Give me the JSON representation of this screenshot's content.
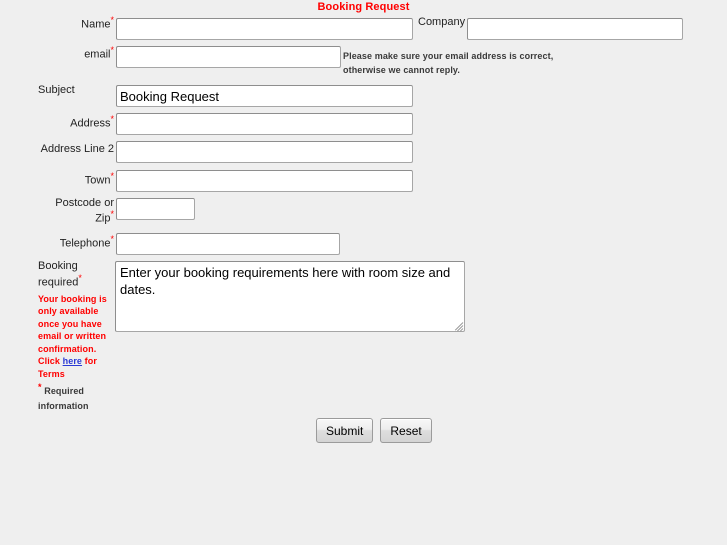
{
  "page": {
    "title": "Booking Request",
    "title_color": "#ff0000",
    "background_color": "#efefef"
  },
  "fields": {
    "name": {
      "label": "Name",
      "required_marker": "*",
      "value": "",
      "placeholder": ""
    },
    "company": {
      "label": "Company",
      "value": "",
      "placeholder": ""
    },
    "email": {
      "label": "email",
      "required_marker": "*",
      "value": "",
      "placeholder": "",
      "note": "Please make sure your email address is correct, otherwise we cannot reply."
    },
    "subject": {
      "label": "Subject",
      "value": "Booking Request",
      "placeholder": ""
    },
    "address": {
      "label": "Address",
      "required_marker": "*",
      "value": "",
      "placeholder": ""
    },
    "address_line_2": {
      "label": "Address Line 2",
      "value": "",
      "placeholder": ""
    },
    "town": {
      "label": "Town",
      "required_marker": "*",
      "value": "",
      "placeholder": ""
    },
    "postcode": {
      "label": "Postcode or Zip",
      "label_line_1": "Postcode or",
      "label_line_2": "Zip",
      "required_marker": "*",
      "value": "",
      "placeholder": ""
    },
    "telephone": {
      "label": "Telephone",
      "required_marker": "*",
      "value": "",
      "placeholder": ""
    },
    "booking_required": {
      "label_line_1": "Booking",
      "label_line_2": "required",
      "required_marker": "*",
      "value": "Enter your booking requirements here with room size and dates.",
      "placeholder": "",
      "warning_before_link": "Your booking is only available once you have email or written confirmation. Click ",
      "warning_link_text": "here",
      "warning_after_link": " for Terms",
      "warning_color": "#ff0000",
      "link_color": "#2a3ad6"
    }
  },
  "legend": {
    "star": "*",
    "text": "Required information"
  },
  "buttons": {
    "submit_label": "Submit",
    "reset_label": "Reset"
  }
}
